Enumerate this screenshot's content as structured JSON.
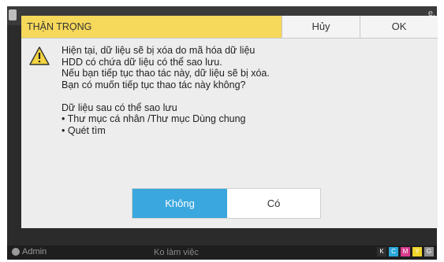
{
  "background": {
    "top_right_text": "e.",
    "status_user": "Admin",
    "status_state": "Ko làm việc",
    "ink_labels": [
      "K",
      "C",
      "M",
      "Y",
      "G"
    ],
    "ink_colors": [
      "#2f2f2f",
      "#2aa7d9",
      "#d93b8c",
      "#f0d52b",
      "#8f8f8f"
    ]
  },
  "dialog": {
    "title": "THẬN TRỌNG",
    "cancel_label": "Hủy",
    "ok_label": "OK",
    "message_lines": [
      "Hiện tại, dữ liệu sẽ bị xóa do mã hóa dữ liệu",
      "HDD có chứa dữ liệu có thể sao lưu.",
      "Nếu bạn tiếp tục thao tác này, dữ liệu sẽ bị xóa.",
      "Bạn có muốn tiếp tục thao tác này không?"
    ],
    "backup_heading": "Dữ liệu sau có thể sao lưu",
    "backup_items": [
      "• Thư mục cá nhân /Thư mục Dùng chung",
      "• Quét tìm"
    ],
    "no_label": "Không",
    "yes_label": "Có",
    "colors": {
      "title_bg": "#f6d85a",
      "no_bg": "#3aa7de",
      "warning_fill": "#f3d341"
    }
  }
}
